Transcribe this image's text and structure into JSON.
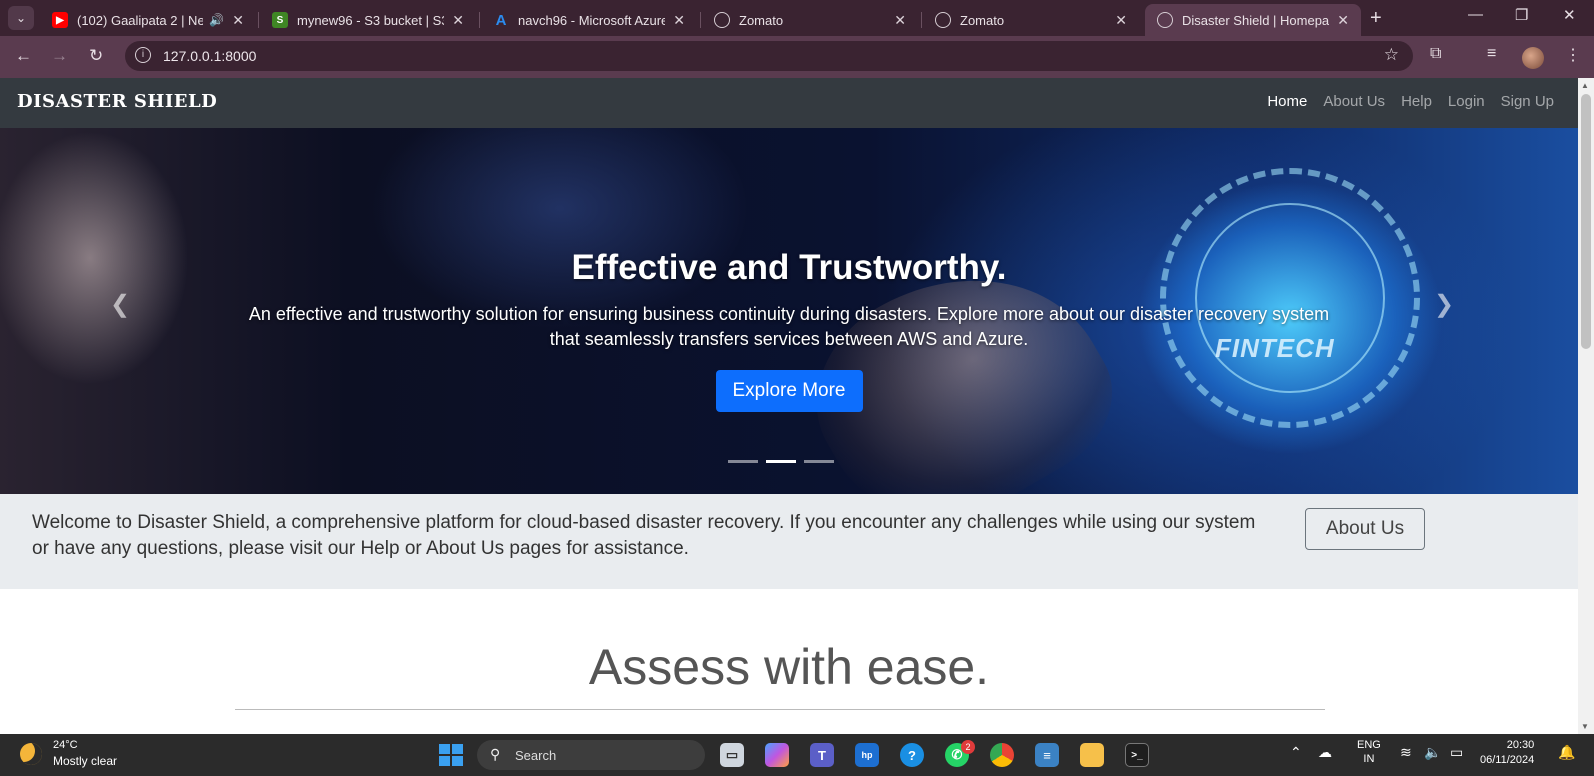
{
  "browser": {
    "tabs": [
      {
        "title": "(102) Gaalipata 2 | Nee",
        "favicon": "youtube-icon",
        "audio": true
      },
      {
        "title": "mynew96 - S3 bucket | S3",
        "favicon": "aws-s3-icon"
      },
      {
        "title": "navch96 - Microsoft Azure",
        "favicon": "azure-icon"
      },
      {
        "title": "Zomato",
        "favicon": "globe-icon"
      },
      {
        "title": "Zomato",
        "favicon": "globe-icon"
      },
      {
        "title": "Disaster Shield | Homepag",
        "favicon": "globe-icon",
        "active": true
      }
    ],
    "url": "127.0.0.1:8000"
  },
  "site": {
    "brand": "DISASTER SHIELD",
    "nav": [
      "Home",
      "About Us",
      "Help",
      "Login",
      "Sign Up"
    ],
    "active_nav": "Home",
    "hero": {
      "title": "Effective and Trustworthy.",
      "text": "An effective and trustworthy solution for ensuring business continuity during disasters. Explore more about our disaster recovery system that seamlessly transfers services between AWS and Azure.",
      "button": "Explore More",
      "image_text": "FINTECH",
      "active_slide": 2,
      "slide_count": 3
    },
    "welcome": {
      "text": "Welcome to Disaster Shield, a comprehensive platform for cloud-based disaster recovery. If you encounter any challenges while using our system or have any questions, please visit our Help or About Us pages for assistance.",
      "button": "About Us"
    },
    "section_title": "Assess with ease."
  },
  "taskbar": {
    "weather_temp": "24°C",
    "weather_desc": "Mostly clear",
    "search_label": "Search",
    "whatsapp_badge": "2",
    "lang_top": "ENG",
    "lang_bottom": "IN",
    "time": "20:30",
    "date": "06/11/2024"
  },
  "colors": {
    "navbar": "#343a40",
    "primary_button": "#0d6efd",
    "welcome_bg": "#e9ecef",
    "browser_frame": "#5a3b4f"
  }
}
